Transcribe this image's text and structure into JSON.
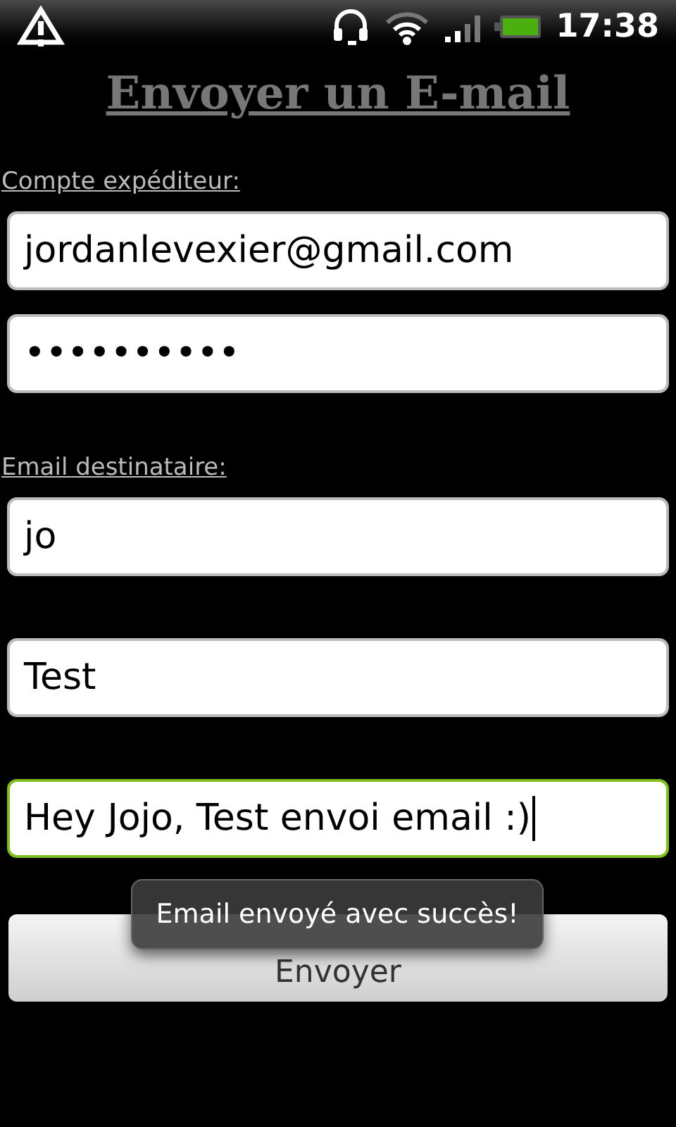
{
  "status_bar": {
    "time": "17:38"
  },
  "title": "Envoyer un E-mail",
  "sections": [
    {
      "label": "Compte expéditeur:",
      "fields": [
        {
          "value": "jordanlevexier@gmail.com",
          "focused": false
        },
        {
          "value": "••••••••••",
          "focused": false
        }
      ]
    },
    {
      "label": "Email destinataire:",
      "fields": [
        {
          "value": "jo",
          "focused": false
        },
        {
          "value": "Test",
          "focused": false
        },
        {
          "value": "Hey Jojo, Test envoi email :)",
          "focused": true
        }
      ]
    }
  ],
  "send_button": "Envoyer",
  "toast": "Email envoyé avec succès!"
}
